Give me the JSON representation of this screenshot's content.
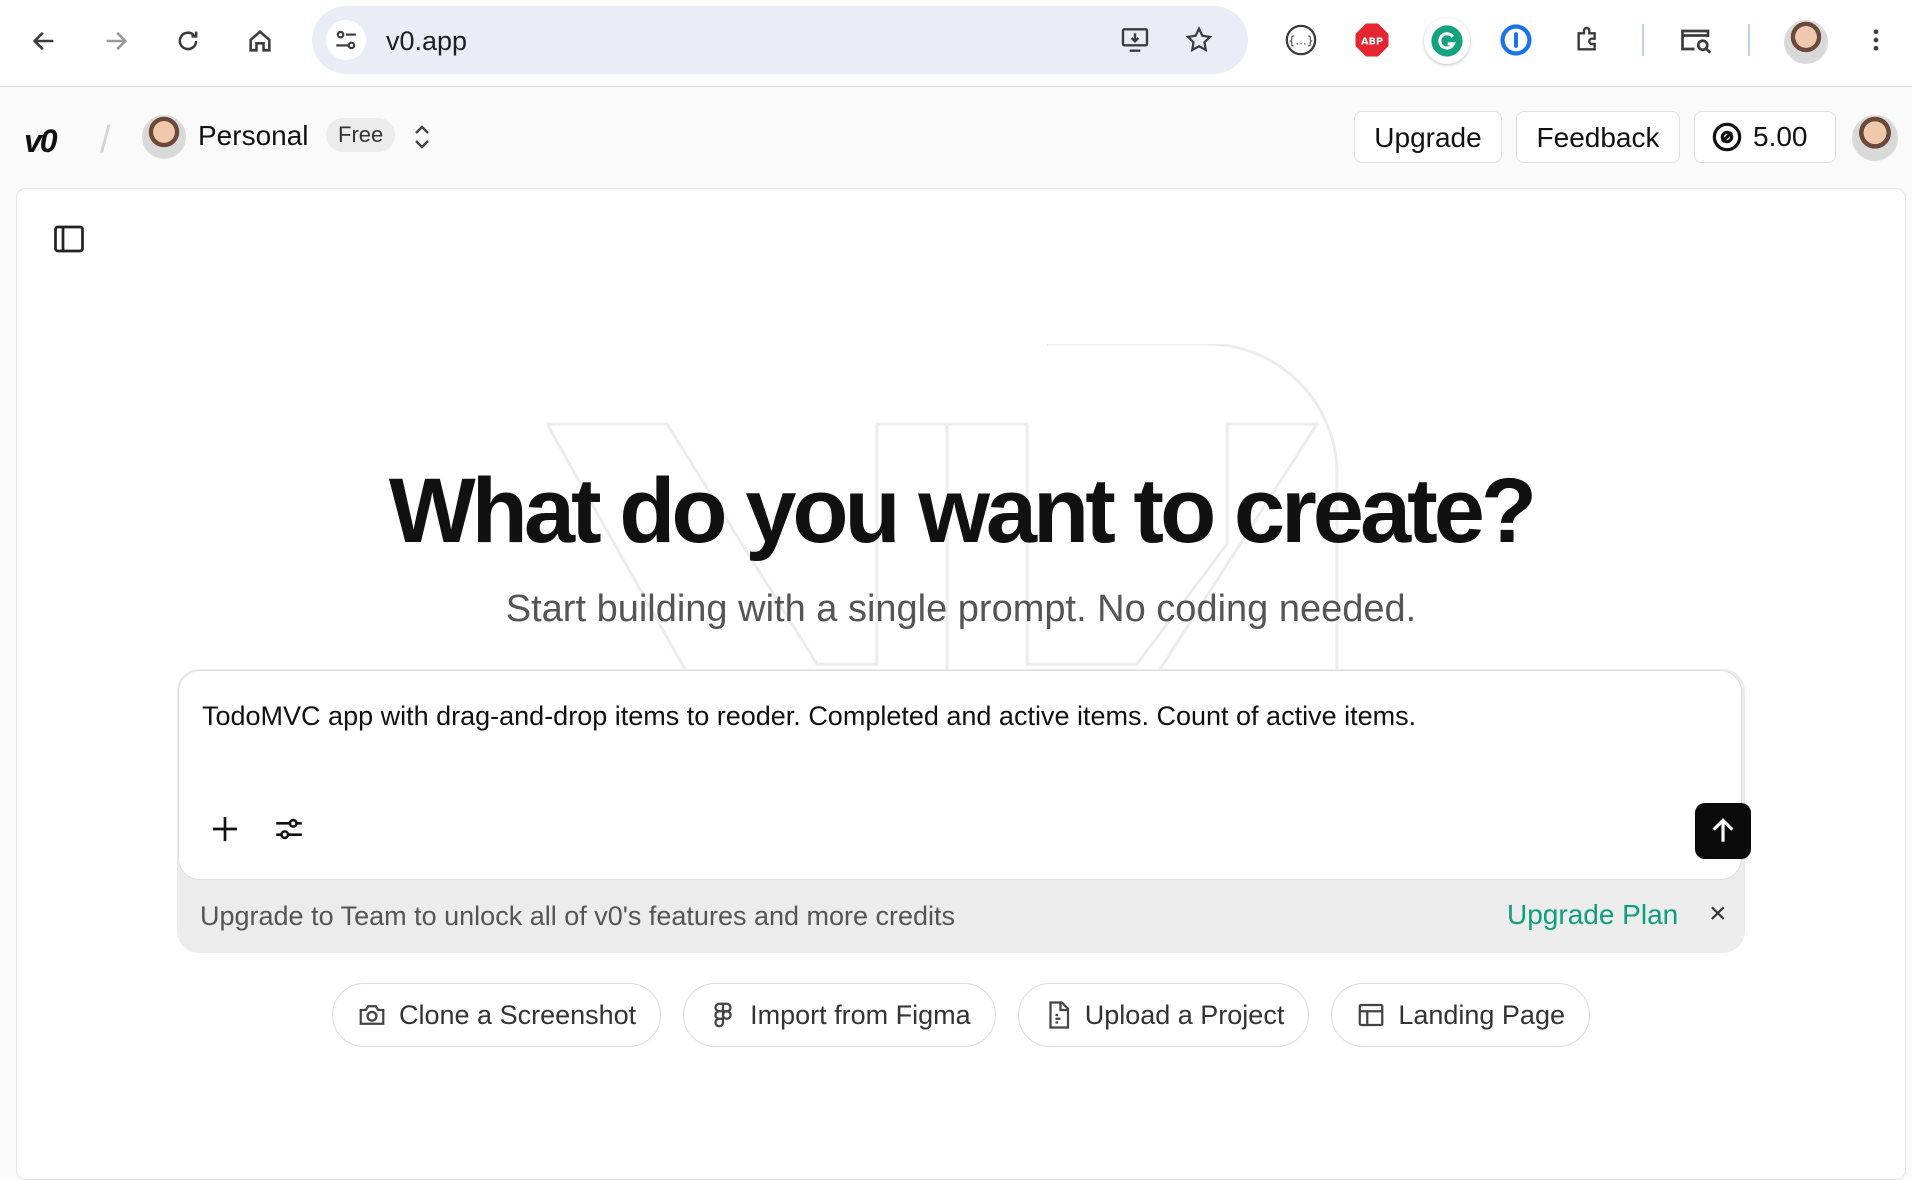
{
  "browser": {
    "url": "v0.app",
    "nav": [
      "back-icon",
      "forward-icon",
      "reload-icon",
      "home-icon"
    ],
    "extensions": [
      "json-viewer-icon",
      "adblock-plus-icon",
      "grammarly-icon",
      "1password-icon",
      "extensions-puzzle-icon",
      "tab-search-icon",
      "profile-avatar",
      "more-menu-icon"
    ],
    "abp_label": "ABP"
  },
  "header": {
    "logo": "v0",
    "workspace": "Personal",
    "plan": "Free",
    "upgrade_label": "Upgrade",
    "feedback_label": "Feedback",
    "credits": "5.00"
  },
  "hero": {
    "title": "What do you want to create?",
    "subtitle": "Start building with a single prompt. No coding needed."
  },
  "prompt": {
    "value": "TodoMVC app with drag-and-drop items to reoder. Completed and active items. Count of active items."
  },
  "upsell": {
    "text": "Upgrade to Team to unlock all of v0's features and more credits",
    "link": "Upgrade Plan",
    "close": "×"
  },
  "suggestions": [
    {
      "label": "Clone a Screenshot",
      "icon": "camera-icon"
    },
    {
      "label": "Import from Figma",
      "icon": "figma-icon"
    },
    {
      "label": "Upload a Project",
      "icon": "file-upload-icon"
    },
    {
      "label": "Landing Page",
      "icon": "layout-icon"
    }
  ],
  "colors": {
    "accent_link": "#0f9e7b",
    "send_button": "#0a0a0a",
    "omnibox": "#e9eef6"
  }
}
